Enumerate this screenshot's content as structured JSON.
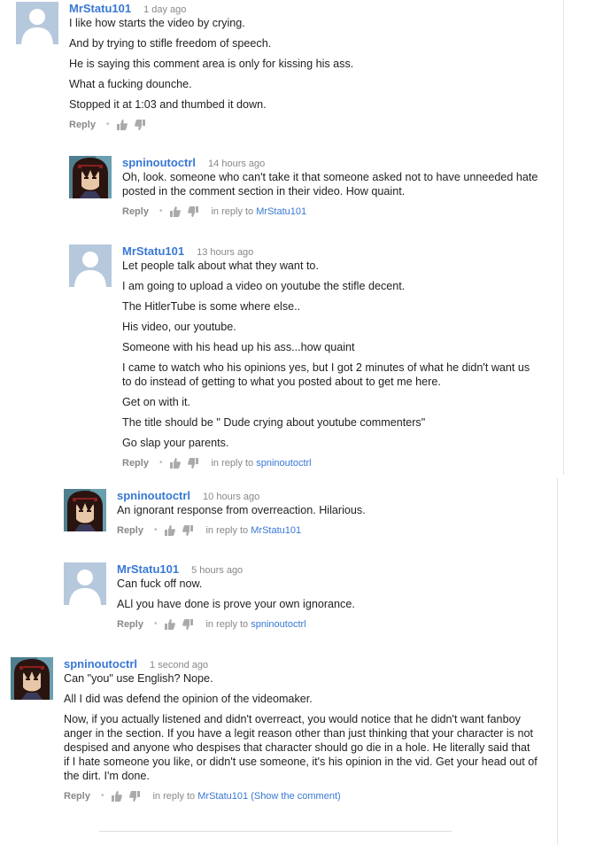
{
  "comments": [
    {
      "author": "MrStatu101",
      "time": "1 day ago",
      "avatar": "default-user-avatar",
      "lines": [
        "I like how starts the video by crying.",
        "And by trying to stifle freedom of speech.",
        "He is saying this comment area is only for kissing his ass.",
        "What a fucking dounche.",
        "Stopped it at 1:03 and thumbed it down."
      ],
      "reply_label": "Reply",
      "in_reply_prefix": "",
      "in_reply_to": ""
    },
    {
      "author": "spninoutoctrl",
      "time": "14 hours ago",
      "avatar": "anime-character-avatar",
      "lines": [
        "Oh, look. someone who can't take it that someone asked not to have unneeded hate posted in the comment section in their video. How quaint."
      ],
      "reply_label": "Reply",
      "in_reply_prefix": "in reply to",
      "in_reply_to": "MrStatu101"
    },
    {
      "author": "MrStatu101",
      "time": "13 hours ago",
      "avatar": "default-user-avatar",
      "lines": [
        "Let people talk about what they want to.",
        "I am going to upload a video on youtube the stifle decent.",
        "The HitlerTube is some where else..",
        "His video, our youtube.",
        "Someone with his head up his ass...how quaint",
        "I came to watch who his opinions yes, but I got 2 minutes of what he didn't want us to do instead of getting to what you posted about to get me here.",
        "Get on with it.",
        "The title should be \" Dude crying about youtube commenters\"",
        "Go slap your parents."
      ],
      "reply_label": "Reply",
      "in_reply_prefix": "in reply to",
      "in_reply_to": "spninoutoctrl"
    },
    {
      "author": "spninoutoctrl",
      "time": "10 hours ago",
      "avatar": "anime-character-avatar",
      "lines": [
        "An ignorant response from overreaction. Hilarious."
      ],
      "reply_label": "Reply",
      "in_reply_prefix": "in reply to",
      "in_reply_to": "MrStatu101"
    },
    {
      "author": "MrStatu101",
      "time": "5 hours ago",
      "avatar": "default-user-avatar",
      "lines": [
        "Can fuck off now.",
        "ALl you have done is prove your own ignorance."
      ],
      "reply_label": "Reply",
      "in_reply_prefix": "in reply to",
      "in_reply_to": "spninoutoctrl"
    },
    {
      "author": "spninoutoctrl",
      "time": "1 second ago",
      "avatar": "anime-character-avatar",
      "lines": [
        "Can \"you\" use English? Nope.",
        "All I did was defend the opinion of the videomaker.",
        "Now, if you actually listened and didn't overreact, you would notice that he didn't want fanboy anger in the section. If you have a legit reason other than just thinking that your character is not despised and anyone who despises that character should go die in a hole. He literally said that if I hate someone you like, or didn't use someone, it's his opinion in the vid. Get your head out of the dirt. I'm done."
      ],
      "reply_label": "Reply",
      "in_reply_prefix": "in reply to",
      "in_reply_to": "MrStatu101",
      "show_comment": "(Show the comment)"
    }
  ],
  "colors": {
    "author": "#3878d4",
    "meta": "#888888",
    "text": "#222222"
  }
}
